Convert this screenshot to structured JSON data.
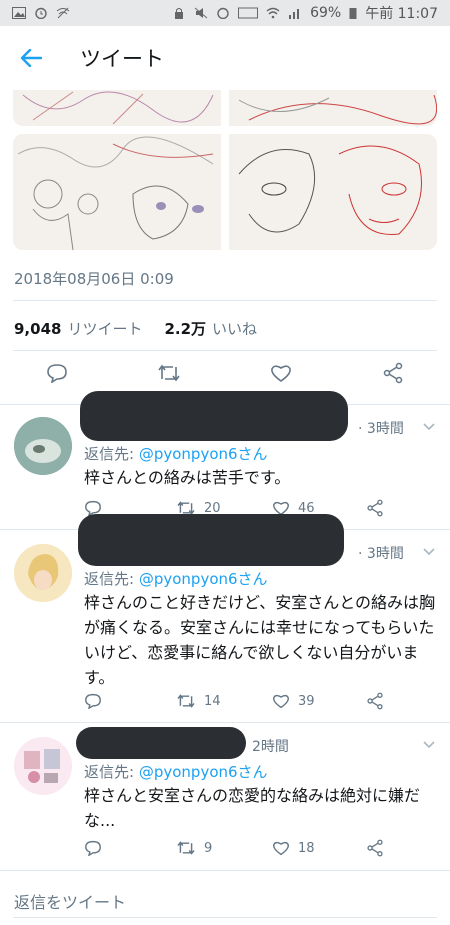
{
  "status_bar": {
    "battery": "69%",
    "time": "午前 11:07"
  },
  "header": {
    "title": "ツイート"
  },
  "tweet": {
    "timestamp": "2018年08月06日 0:09",
    "retweets_count": "9,048",
    "retweets_label": "リツイート",
    "likes_count": "2.2万",
    "likes_label": "いいね"
  },
  "replies": [
    {
      "time": "3時間",
      "reply_to_label": "返信先:",
      "reply_to_handle": "@pyonpyon6さん",
      "text": "梓さんとの絡みは苦手です。",
      "retweets": "20",
      "likes": "46"
    },
    {
      "time": "3時間",
      "reply_to_label": "返信先:",
      "reply_to_handle": "@pyonpyon6さん",
      "text": "梓さんのこと好きだけど、安室さんとの絡みは胸が痛くなる。安室さんには幸せになってもらいたいけど、恋愛事に絡んで欲しくない自分がいます。",
      "retweets": "14",
      "likes": "39"
    },
    {
      "time": "2時間",
      "reply_to_label": "返信先:",
      "reply_to_handle": "@pyonpyon6さん",
      "text": "梓さんと安室さんの恋愛的な絡みは絶対に嫌だな...",
      "retweets": "9",
      "likes": "18"
    }
  ],
  "compose": {
    "placeholder": "返信をツイート"
  },
  "colors": {
    "accent": "#1da1f2",
    "muted": "#657786",
    "redaction": "#2b2f33"
  }
}
